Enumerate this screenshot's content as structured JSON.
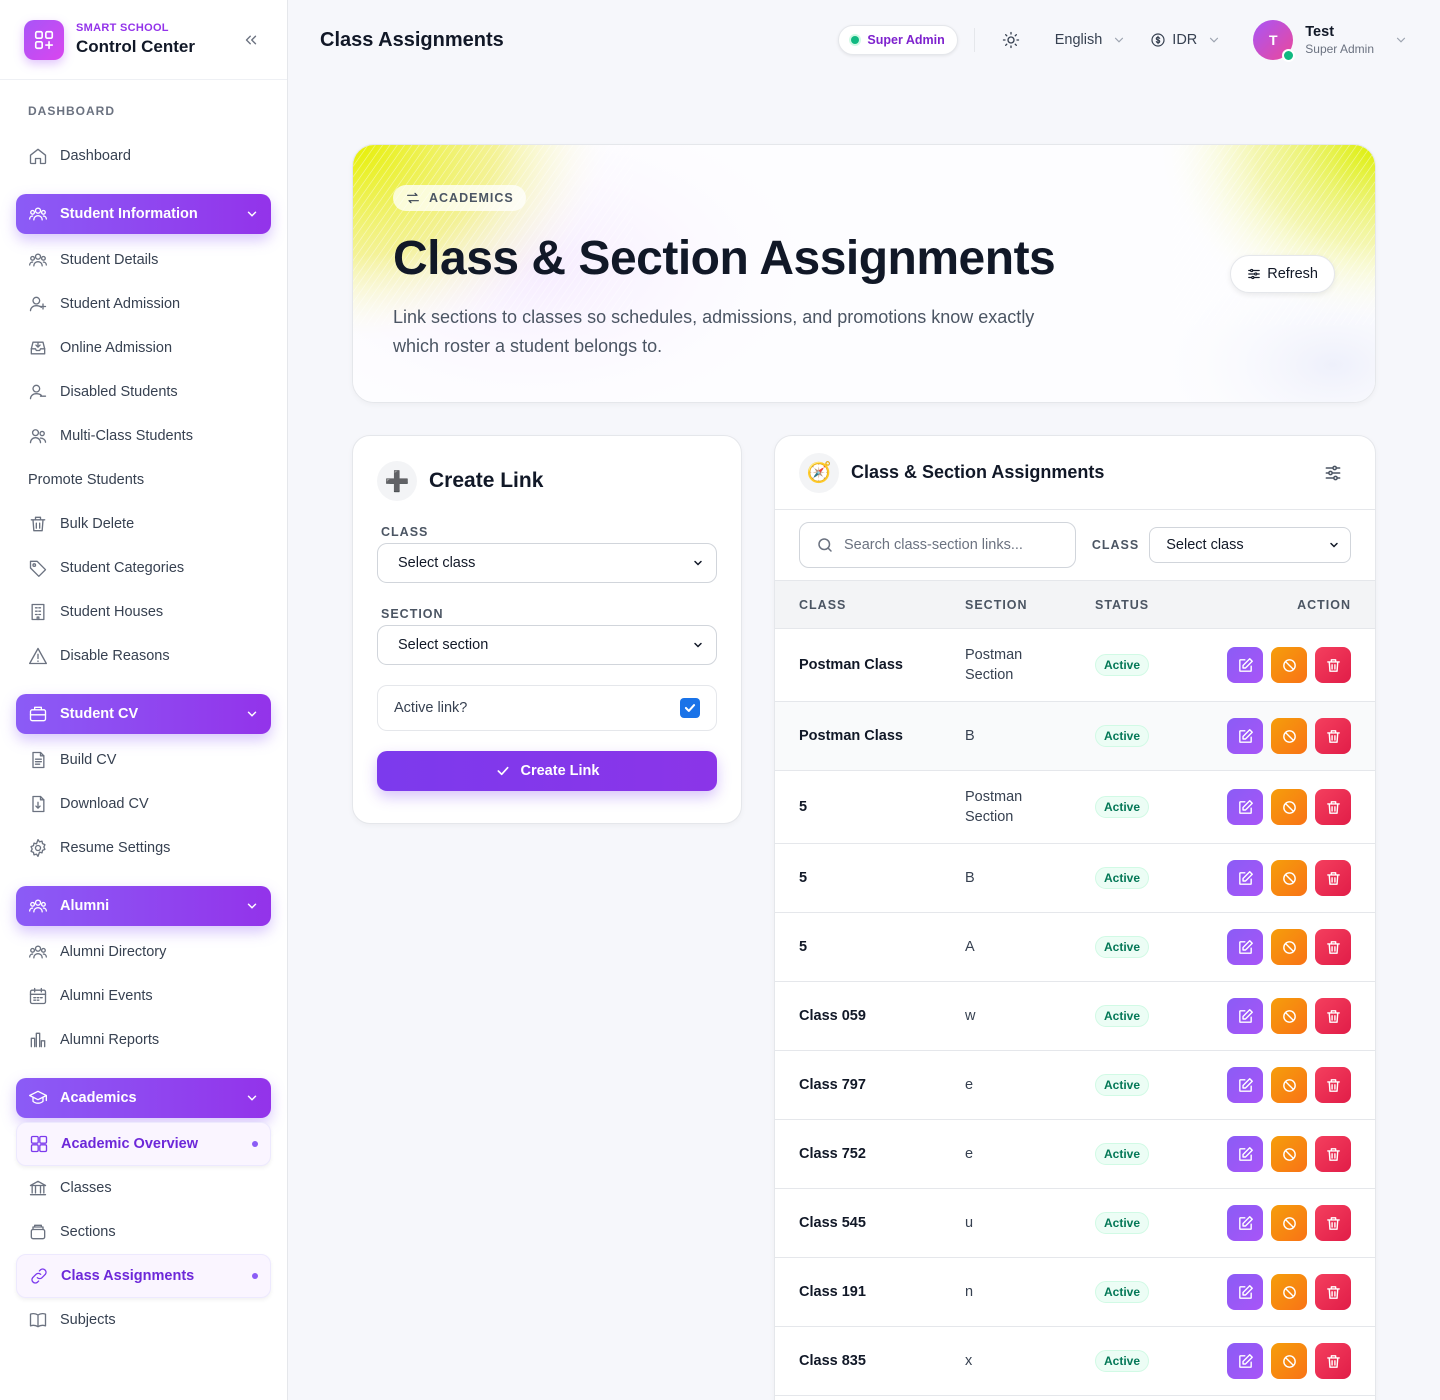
{
  "brand": {
    "subtitle": "SMART SCHOOL",
    "title": "Control Center"
  },
  "sidebar": {
    "section_label": "DASHBOARD",
    "dashboard": "Dashboard",
    "groups": [
      {
        "label": "Student Information",
        "icon": "users-icon",
        "items": [
          {
            "label": "Student Details",
            "icon": "users-icon"
          },
          {
            "label": "Student Admission",
            "icon": "user-plus-icon"
          },
          {
            "label": "Online Admission",
            "icon": "inbox-icon"
          },
          {
            "label": "Disabled Students",
            "icon": "user-minus-icon"
          },
          {
            "label": "Multi-Class Students",
            "icon": "user-group-icon"
          },
          {
            "label": "Promote Students",
            "icon": ""
          },
          {
            "label": "Bulk Delete",
            "icon": "trash-icon"
          },
          {
            "label": "Student Categories",
            "icon": "tag-icon"
          },
          {
            "label": "Student Houses",
            "icon": "building-icon"
          },
          {
            "label": "Disable Reasons",
            "icon": "warning-icon"
          }
        ]
      },
      {
        "label": "Student CV",
        "icon": "briefcase-icon",
        "items": [
          {
            "label": "Build CV",
            "icon": "document-icon"
          },
          {
            "label": "Download CV",
            "icon": "download-doc-icon"
          },
          {
            "label": "Resume Settings",
            "icon": "gear-icon"
          }
        ]
      },
      {
        "label": "Alumni",
        "icon": "users-icon",
        "items": [
          {
            "label": "Alumni Directory",
            "icon": "users-icon"
          },
          {
            "label": "Alumni Events",
            "icon": "calendar-icon"
          },
          {
            "label": "Alumni Reports",
            "icon": "bar-chart-icon"
          }
        ]
      },
      {
        "label": "Academics",
        "icon": "graduation-cap-icon",
        "items": [
          {
            "label": "Academic Overview",
            "icon": "grid-icon",
            "active": true
          },
          {
            "label": "Classes",
            "icon": "bank-icon"
          },
          {
            "label": "Sections",
            "icon": "stack-icon"
          },
          {
            "label": "Class Assignments",
            "icon": "link-icon",
            "active": true
          },
          {
            "label": "Subjects",
            "icon": "book-icon"
          }
        ]
      }
    ]
  },
  "topbar": {
    "title": "Class Assignments",
    "role_badge": "Super Admin",
    "language": "English",
    "currency": "IDR",
    "user": {
      "initial": "T",
      "name": "Test",
      "role": "Super Admin"
    }
  },
  "hero": {
    "chip": "ACADEMICS",
    "title": "Class & Section Assignments",
    "description": "Link sections to classes so schedules, admissions, and promotions know exactly which roster a student belongs to.",
    "refresh_label": "Refresh"
  },
  "create_form": {
    "emoji": "➕",
    "title": "Create Link",
    "class_label": "CLASS",
    "class_value": "Select class",
    "section_label": "SECTION",
    "section_value": "Select section",
    "active_label": "Active link?",
    "active_checked": true,
    "submit_label": "Create Link"
  },
  "assignments": {
    "emoji": "🧭",
    "title": "Class & Section Assignments",
    "search_placeholder": "Search class-section links...",
    "filter_label": "CLASS",
    "filter_value": "Select class",
    "columns": [
      "CLASS",
      "SECTION",
      "STATUS",
      "ACTION"
    ],
    "rows": [
      {
        "class": "Postman Class",
        "section": "Postman Section",
        "status": "Active"
      },
      {
        "class": "Postman Class",
        "section": "B",
        "status": "Active"
      },
      {
        "class": "5",
        "section": "Postman Section",
        "status": "Active"
      },
      {
        "class": "5",
        "section": "B",
        "status": "Active"
      },
      {
        "class": "5",
        "section": "A",
        "status": "Active"
      },
      {
        "class": "Class 059",
        "section": "w",
        "status": "Active"
      },
      {
        "class": "Class 797",
        "section": "e",
        "status": "Active"
      },
      {
        "class": "Class 752",
        "section": "e",
        "status": "Active"
      },
      {
        "class": "Class 545",
        "section": "u",
        "status": "Active"
      },
      {
        "class": "Class 191",
        "section": "n",
        "status": "Active"
      },
      {
        "class": "Class 835",
        "section": "x",
        "status": "Active"
      }
    ]
  },
  "colors": {
    "accent": "#8b5cf6",
    "success": "#10b981",
    "warning": "#f59e0b",
    "danger": "#e11d48"
  }
}
